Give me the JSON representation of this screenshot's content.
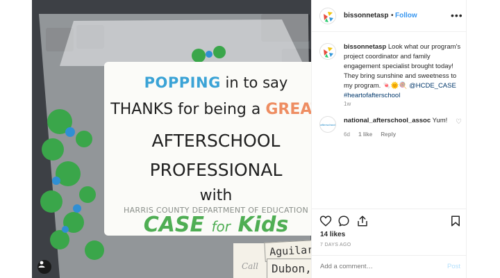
{
  "post": {
    "username": "bissonnetasp",
    "separator": "•",
    "follow": "Follow",
    "more": "•••",
    "caption": {
      "username": "bissonnetasp",
      "text": "Look what our program's project coordinator and family engagement specialist brought today! They bring sunshine and sweetness to my program. 🍬🌞🍭",
      "mention": "@HCDE_CASE",
      "hashtag": "#heartofafterschool",
      "time": "1w"
    },
    "comments": [
      {
        "username": "national_afterschool_assoc",
        "avatar_text": "afterschool",
        "text": "Yum!",
        "time": "6d",
        "likes": "1 like",
        "reply": "Reply"
      }
    ],
    "likes": "14 likes",
    "posted": "7 DAYS AGO",
    "comment_placeholder": "Add a comment…",
    "post_button": "Post"
  },
  "photo": {
    "card": {
      "line1_highlight": "POPPING",
      "line1_rest": "in to say",
      "line2_start": "THANKS for being a",
      "line2_highlight": "GREAT",
      "line3": "AFTERSCHOOL",
      "line4": "PROFESSIONAL",
      "line5": "with",
      "org": "HARRIS COUNTY DEPARTMENT OF EDUCATION",
      "logo_start": "CASE",
      "logo_mid": "for",
      "logo_end": "Kids"
    },
    "tag_top": "Aguilar,",
    "tag_bottom": "Dubon,",
    "note": "Call"
  },
  "icons": {
    "like": "heart-icon",
    "comment": "comment-icon",
    "share": "share-icon",
    "save": "bookmark-icon",
    "more": "more-icon",
    "user_tag": "user-tag-icon"
  }
}
